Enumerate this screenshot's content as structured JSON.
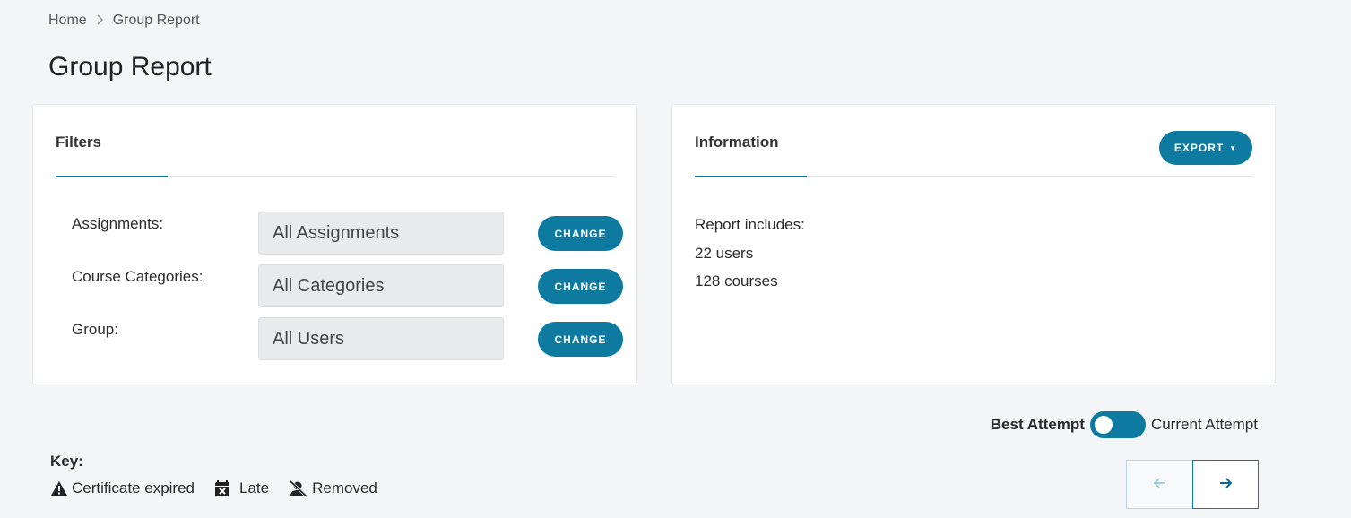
{
  "breadcrumb": {
    "home": "Home",
    "current": "Group Report"
  },
  "page": {
    "title": "Group Report"
  },
  "filters": {
    "tab_label": "Filters",
    "rows": [
      {
        "label": "Assignments:",
        "value": "All Assignments",
        "button": "CHANGE"
      },
      {
        "label": "Course Categories:",
        "value": "All Categories",
        "button": "CHANGE"
      },
      {
        "label": "Group:",
        "value": "All Users",
        "button": "CHANGE"
      }
    ]
  },
  "information": {
    "tab_label": "Information",
    "export_label": "EXPORT",
    "lines": [
      "Report includes:",
      "22 users",
      "128 courses"
    ]
  },
  "attempt_toggle": {
    "left_label": "Best Attempt",
    "right_label": "Current Attempt"
  },
  "key": {
    "title": "Key:",
    "items": [
      {
        "icon": "warning-icon",
        "label": "Certificate expired"
      },
      {
        "icon": "calendar-x-icon",
        "label": "Late"
      },
      {
        "icon": "user-slash-icon",
        "label": "Removed"
      }
    ]
  },
  "pagination": {
    "prev_icon": "arrow-left-icon",
    "next_icon": "arrow-right-icon"
  },
  "colors": {
    "accent": "#0e7aa0",
    "background": "#f4f5f7"
  }
}
